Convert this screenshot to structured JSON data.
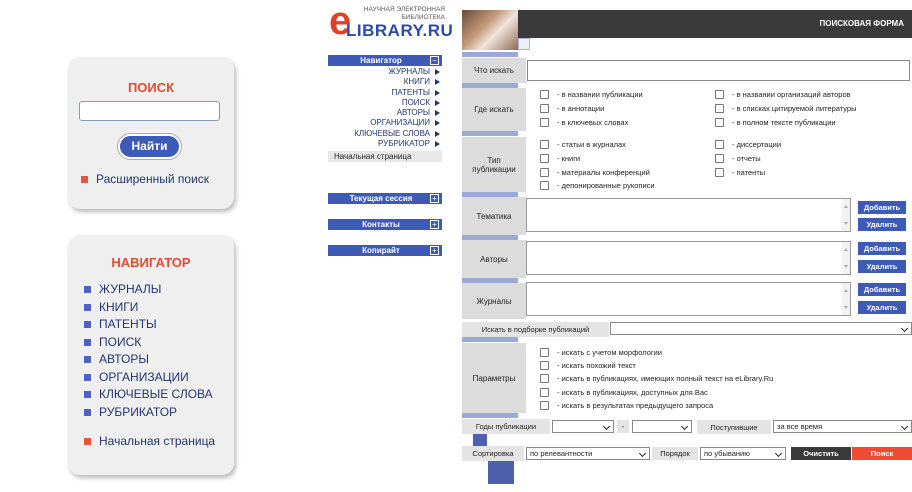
{
  "left": {
    "search_widget": {
      "title": "ПОИСК",
      "input_value": "",
      "button": "Найти",
      "advanced_link": "Расширенный поиск"
    },
    "navigator_widget": {
      "title": "НАВИГАТОР",
      "items": [
        "ЖУРНАЛЫ",
        "КНИГИ",
        "ПАТЕНТЫ",
        "ПОИСК",
        "АВТОРЫ",
        "ОРГАНИЗАЦИИ",
        "КЛЮЧЕВЫЕ СЛОВА",
        "РУБРИКАТОР"
      ],
      "home_link": "Начальная страница"
    }
  },
  "logo": {
    "letter": "e",
    "tagline_line1": "НАУЧНАЯ ЭЛЕКТРОННАЯ",
    "tagline_line2": "БИБЛИОТЕКА",
    "name": "LIBRARY.RU"
  },
  "center_nav": {
    "navigator": {
      "title": "Навигатор",
      "toggle": "−",
      "links": [
        "ЖУРНАЛЫ",
        "КНИГИ",
        "ПАТЕНТЫ",
        "ПОИСК",
        "АВТОРЫ",
        "ОРГАНИЗАЦИИ",
        "КЛЮЧЕВЫЕ СЛОВА",
        "РУБРИКАТОР"
      ],
      "home": "Начальная страница"
    },
    "collapsed": [
      {
        "title": "Текущая сессия",
        "toggle": "+"
      },
      {
        "title": "Контакты",
        "toggle": "+"
      },
      {
        "title": "Копирайт",
        "toggle": "+"
      }
    ]
  },
  "form": {
    "header_title": "ПОИСКОВАЯ ФОРМА",
    "what_label": "Что искать",
    "what_value": "",
    "where_label": "Где искать",
    "where_options": [
      "- в названии публикации",
      "- в названии организаций авторов",
      "- в аннотации",
      "- в списках цитируемой литературы",
      "- в ключевых словах",
      "- в полном тексте публикации"
    ],
    "type_label": "Тип публикации",
    "type_options": [
      "- статьи в журналах",
      "- диссертации",
      "- книги",
      "- отчеты",
      "- материалы конференций",
      "- патенты",
      "- депонированные рукописи"
    ],
    "subject_label": "Тематика",
    "authors_label": "Авторы",
    "journals_label": "Журналы",
    "add_button": "Добавить",
    "remove_button": "Удалить",
    "collection_label": "Искать в подборке публикаций",
    "collection_value": "",
    "params_label": "Параметры",
    "params_options": [
      "- искать с учетом морфологии",
      "- искать похожий текст",
      "- искать в публикациях, имеющих полный текст на eLibrary.Ru",
      "- искать в публикациях, доступных для Вас",
      "- искать в результатах предыдущего запроса"
    ],
    "years_label": "Годы публикации",
    "years_from": "",
    "years_dash": "-",
    "years_to": "",
    "received_label": "Поступившие",
    "received_value": "за все время",
    "sort_label": "Сортировка",
    "sort_value": "по релевантности",
    "order_label": "Порядок",
    "order_value": "по убыванию",
    "clear_button": "Очистить",
    "search_button": "Поиск"
  },
  "colors": {
    "accent_red": "#e34b2f",
    "nav_blue": "#3d5ab6",
    "header_dark": "#3a3a3a",
    "search_btn_red": "#ee4b32"
  }
}
